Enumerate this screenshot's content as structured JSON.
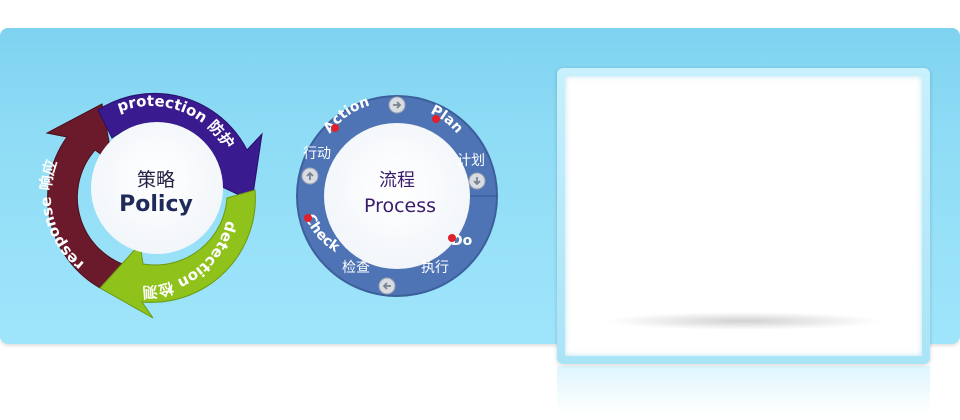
{
  "policy_cycle": {
    "center_cn": "策略",
    "center_en": "Policy",
    "protection": "protection 防护",
    "detection": "detection 检测",
    "response": "response 响应"
  },
  "process_cycle": {
    "center_cn": "流程",
    "center_en": "Process",
    "action": "Action",
    "plan": "Plan",
    "do": "Do",
    "check": "Check",
    "action_cn": "行动",
    "plan_cn": "计划",
    "do_cn": "执行",
    "check_cn": "检查"
  },
  "colors": {
    "banner": "#8fdcf6",
    "protection": "#3a1b8f",
    "detection": "#8fc21b",
    "response": "#6a1a2a",
    "ring": "#4f74b5",
    "accent_red": "#e0202a"
  }
}
